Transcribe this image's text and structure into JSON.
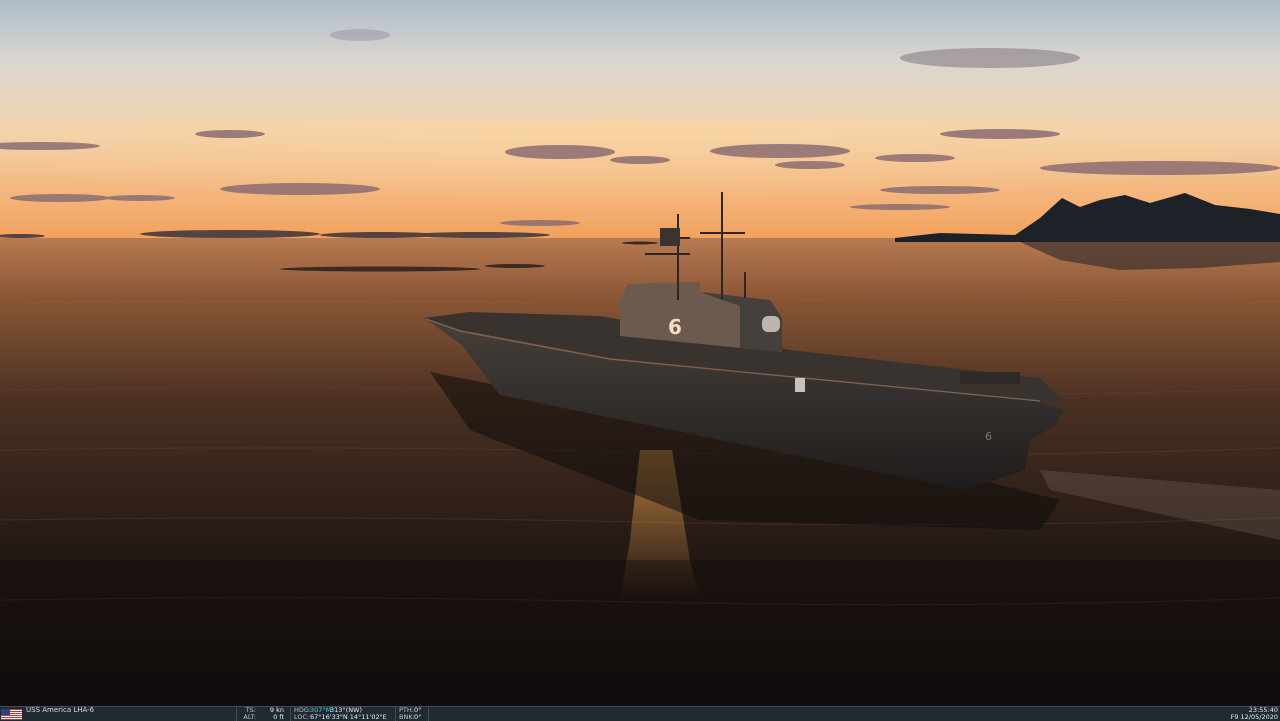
{
  "scene": {
    "description_icon": "amphibious-assault-ship",
    "hull_number": "6",
    "colors": {
      "sky_top": "#b7c3cf",
      "sky_horizon": "#f3a45e",
      "water_near": "#15110f",
      "water_far": "#b4714a",
      "ship": "#2a2827",
      "island": "#1e2328"
    }
  },
  "statusbar": {
    "flag_icon": "us-flag-icon",
    "unit_name": "USS America LHA-6",
    "ts_label": "TS:",
    "ts_value": "9 kn",
    "alt_label": "ALT:",
    "alt_value": "0 ft",
    "hdg_label": "HDG:",
    "hdg_magnetic": "307°M",
    "hdg_true": "313°(NW)",
    "loc_label": "LOC:",
    "loc_value": "67°16'33\"N 14°11'02\"E",
    "pth_label": "PTH:",
    "pth_value": "0°",
    "bnk_label": "BNK:",
    "bnk_value": "0°",
    "time": "23:55:40",
    "date": "F9 12/05/2020"
  }
}
